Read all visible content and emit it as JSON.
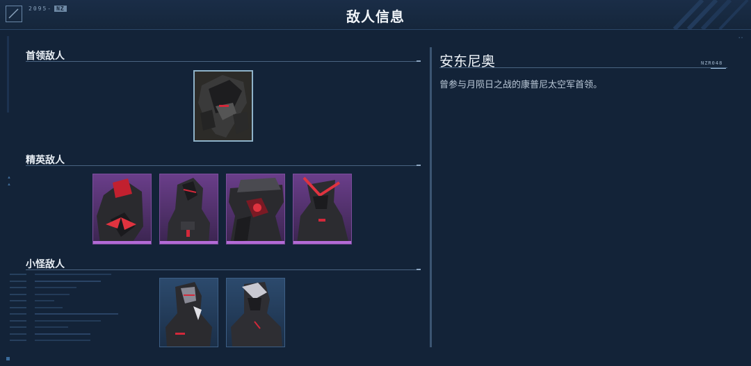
{
  "header": {
    "title": "敌人信息",
    "logo_code": "2095-",
    "logo_tag": "NZ"
  },
  "left_panel": {
    "sections": [
      {
        "title": "首领敌人"
      },
      {
        "title": "精英敌人"
      },
      {
        "title": "小怪敌人"
      }
    ]
  },
  "detail": {
    "name": "安东尼奥",
    "code": "NZR048",
    "description": "曾参与月陨日之战的康普尼太空军首领。"
  },
  "colors": {
    "background": "#132338",
    "boss_frame": "#8fb3c9",
    "elite_frame": "#7c4d9c",
    "elite_bar": "#b36ad6",
    "minion_frame": "#3d5f86",
    "accent_red": "#d3283a"
  }
}
